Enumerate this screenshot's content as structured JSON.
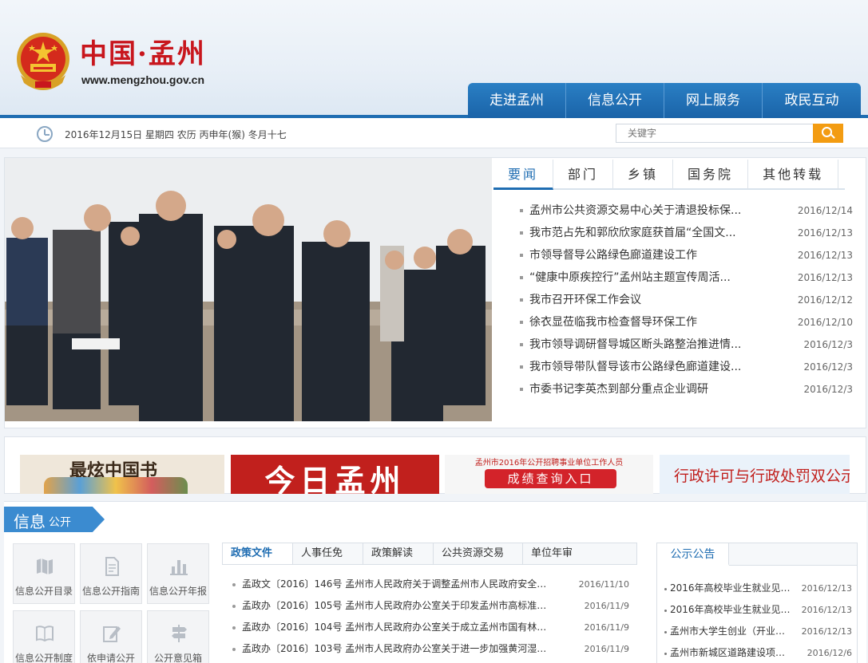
{
  "site": {
    "title": "中国·孟州",
    "domain": "www.mengzhou.gov.cn"
  },
  "nav": [
    "走进孟州",
    "信息公开",
    "网上服务",
    "政民互动"
  ],
  "datebar": {
    "date_text": "2016年12月15日  星期四  农历 丙申年(猴) 冬月十七",
    "search_placeholder": "关键字"
  },
  "news": {
    "tabs": [
      "要闻",
      "部门",
      "乡镇",
      "国务院",
      "其他转载"
    ],
    "active_tab": 0,
    "items": [
      {
        "title": "孟州市公共资源交易中心关于清退投标保...",
        "date": "2016/12/14"
      },
      {
        "title": "我市范占先和郭欣欣家庭获首届“全国文...",
        "date": "2016/12/13"
      },
      {
        "title": "市领导督导公路绿色廊道建设工作",
        "date": "2016/12/13"
      },
      {
        "title": "“健康中原疾控行”孟州站主题宣传周活...",
        "date": "2016/12/13"
      },
      {
        "title": "我市召开环保工作会议",
        "date": "2016/12/12"
      },
      {
        "title": "徐衣显莅临我市检查督导环保工作",
        "date": "2016/12/10"
      },
      {
        "title": "我市领导调研督导城区断头路整治推进情...",
        "date": "2016/12/3"
      },
      {
        "title": "我市领导带队督导该市公路绿色廊道建设...",
        "date": "2016/12/3"
      },
      {
        "title": "市委书记李英杰到部分重点企业调研",
        "date": "2016/12/3"
      }
    ]
  },
  "banners": {
    "b1_text": "最炫中国书",
    "b2_text": "今日孟州",
    "b3_top": "孟州市2016年公开招聘事业单位工作人员",
    "b3_button": "成绩查询入口",
    "b4_text": "行政许可与行政处罚双公示"
  },
  "info": {
    "ribbon_big": "信息",
    "ribbon_small": "公开",
    "tiles": [
      {
        "label": "信息公开目录",
        "icon": "map-icon"
      },
      {
        "label": "信息公开指南",
        "icon": "document-icon"
      },
      {
        "label": "信息公开年报",
        "icon": "bar-chart-icon"
      },
      {
        "label": "信息公开制度",
        "icon": "book-icon"
      },
      {
        "label": "依申请公开",
        "icon": "edit-icon"
      },
      {
        "label": "公开意见箱",
        "icon": "signpost-icon"
      }
    ],
    "policy_tabs": [
      "政策文件",
      "人事任免",
      "政策解读",
      "公共资源交易",
      "单位年审"
    ],
    "policy_items": [
      {
        "title": "孟政文〔2016〕146号 孟州市人民政府关于调整孟州市人民政府安全…",
        "date": "2016/11/10"
      },
      {
        "title": "孟政办〔2016〕105号 孟州市人民政府办公室关于印发孟州市高标准…",
        "date": "2016/11/9"
      },
      {
        "title": "孟政办〔2016〕104号 孟州市人民政府办公室关于成立孟州市国有林…",
        "date": "2016/11/9"
      },
      {
        "title": "孟政办〔2016〕103号 孟州市人民政府办公室关于进一步加强黄河湿…",
        "date": "2016/11/9"
      }
    ],
    "notice_tab": "公示公告",
    "notice_items": [
      {
        "title": "2016年高校毕业生就业见…",
        "date": "2016/12/13"
      },
      {
        "title": "2016年高校毕业生就业见…",
        "date": "2016/12/13"
      },
      {
        "title": "孟州市大学生创业（开业…",
        "date": "2016/12/13"
      },
      {
        "title": "孟州市新城区道路建设项…",
        "date": "2016/12/6"
      }
    ]
  },
  "colors": {
    "brand_blue": "#1f6db2",
    "title_red": "#c8161d",
    "search_orange": "#f39c12"
  }
}
